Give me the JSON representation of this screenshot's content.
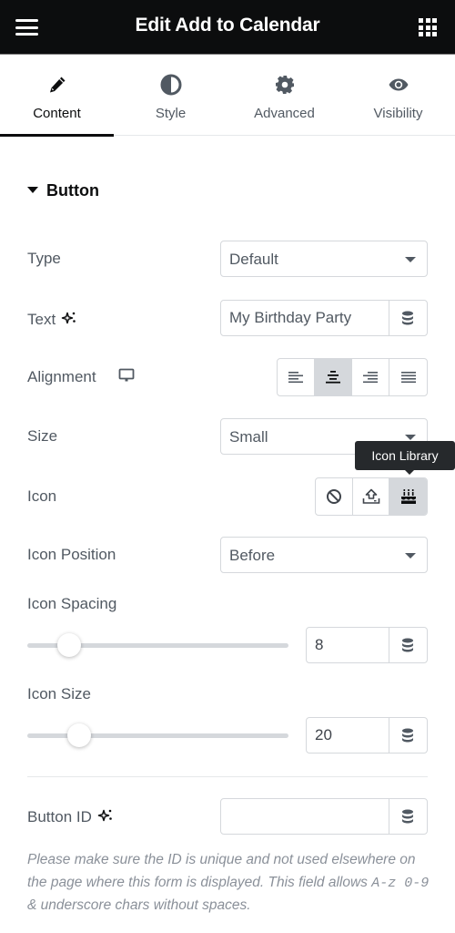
{
  "header": {
    "title": "Edit Add to Calendar",
    "menu_icon": "hamburger-icon",
    "apps_icon": "grid-icon"
  },
  "tabs": [
    {
      "label": "Content",
      "icon": "pencil-icon",
      "active": true
    },
    {
      "label": "Style",
      "icon": "half-circle-icon",
      "active": false
    },
    {
      "label": "Advanced",
      "icon": "gear-icon",
      "active": false
    },
    {
      "label": "Visibility",
      "icon": "eye-icon",
      "active": false
    }
  ],
  "section": {
    "title": "Button",
    "expanded": true
  },
  "controls": {
    "type": {
      "label": "Type",
      "value": "Default"
    },
    "text": {
      "label": "Text",
      "value": "My Birthday Party",
      "ai_icon": "sparkle-icon",
      "dynamic_icon": "database-icon"
    },
    "alignment": {
      "label": "Alignment",
      "device_icon": "desktop-icon",
      "options": [
        {
          "name": "left",
          "icon": "align-left-icon",
          "active": false
        },
        {
          "name": "center",
          "icon": "align-center-icon",
          "active": true
        },
        {
          "name": "right",
          "icon": "align-right-icon",
          "active": false
        },
        {
          "name": "justify",
          "icon": "align-justify-icon",
          "active": false
        }
      ]
    },
    "size": {
      "label": "Size",
      "value": "Small"
    },
    "icon": {
      "label": "Icon",
      "options": [
        {
          "name": "none",
          "icon": "ban-icon",
          "active": false
        },
        {
          "name": "upload-svg",
          "icon": "upload-icon",
          "active": false
        },
        {
          "name": "icon-library",
          "icon": "birthday-cake-icon",
          "active": true
        }
      ],
      "tooltip": "Icon Library"
    },
    "icon_position": {
      "label": "Icon Position",
      "value": "Before"
    },
    "icon_spacing": {
      "label": "Icon Spacing",
      "value": "8",
      "slider_fraction": 0.16
    },
    "icon_size": {
      "label": "Icon Size",
      "value": "20",
      "slider_fraction": 0.2
    },
    "button_id": {
      "label": "Button ID",
      "value": "",
      "help_text_1": "Please make sure the ID is unique and not used elsewhere on the page where this form is displayed. This field allows ",
      "help_code": "A-z 0-9",
      "help_text_2": " & underscore chars without spaces."
    }
  }
}
